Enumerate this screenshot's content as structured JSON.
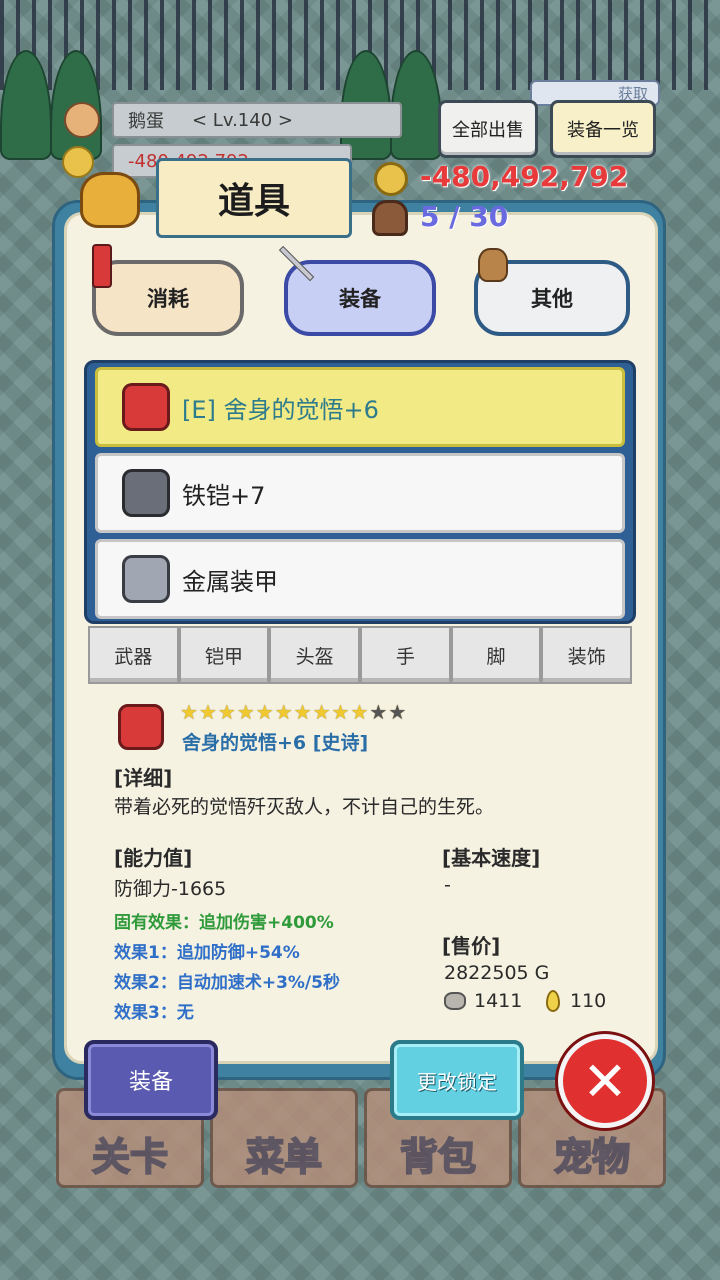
{
  "player": {
    "name": "鹅蛋",
    "level": "< Lv.140 >",
    "gold_small": "-480,492,792"
  },
  "header_buttons": {
    "sell_all": "全部出售",
    "equip_list": "装备一览",
    "obtain": "获取"
  },
  "panel": {
    "title": "道具",
    "gold": "-480,492,792",
    "capacity": "5 / 30"
  },
  "categories": [
    {
      "label": "消耗"
    },
    {
      "label": "装备"
    },
    {
      "label": "其他"
    }
  ],
  "items": [
    {
      "name": "[E] 舍身的觉悟+6",
      "selected": true,
      "icon": "red-armor-icon"
    },
    {
      "name": "铁铠+7",
      "selected": false,
      "icon": "iron-armor-icon"
    },
    {
      "name": "金属装甲",
      "selected": false,
      "icon": "metal-armor-icon"
    }
  ],
  "slot_tabs": [
    "武器",
    "铠甲",
    "头盔",
    "手",
    "脚",
    "装饰"
  ],
  "detail": {
    "stars_filled": 10,
    "stars_total": 12,
    "item_title": "舍身的觉悟+6 [史诗]",
    "detail_header": "[详细]",
    "description": "带着必死的觉悟歼灭敌人，不计自己的生死。",
    "stats_header": "[能力值]",
    "stat": "防御力-1665",
    "inherent": "固有效果：追加伤害+400%",
    "effect1": "效果1：追加防御+54%",
    "effect2": "效果2：自动加速术+3%/5秒",
    "effect3": "效果3：无",
    "speed_header": "[基本速度]",
    "speed": "-",
    "price_header": "[售价]",
    "price": "2822505 G",
    "ore": "1411",
    "drop": "110"
  },
  "actions": {
    "equip": "装备",
    "lock": "更改锁定"
  },
  "bottom_nav": [
    "关卡",
    "菜单",
    "背包",
    "宠物"
  ],
  "colors": {
    "panel": "#3f81a1",
    "selected_item": "#f2ea84",
    "inherent": "#2f9a3a",
    "effect": "#2f6fc8",
    "title_blue": "#2a6ea8"
  }
}
